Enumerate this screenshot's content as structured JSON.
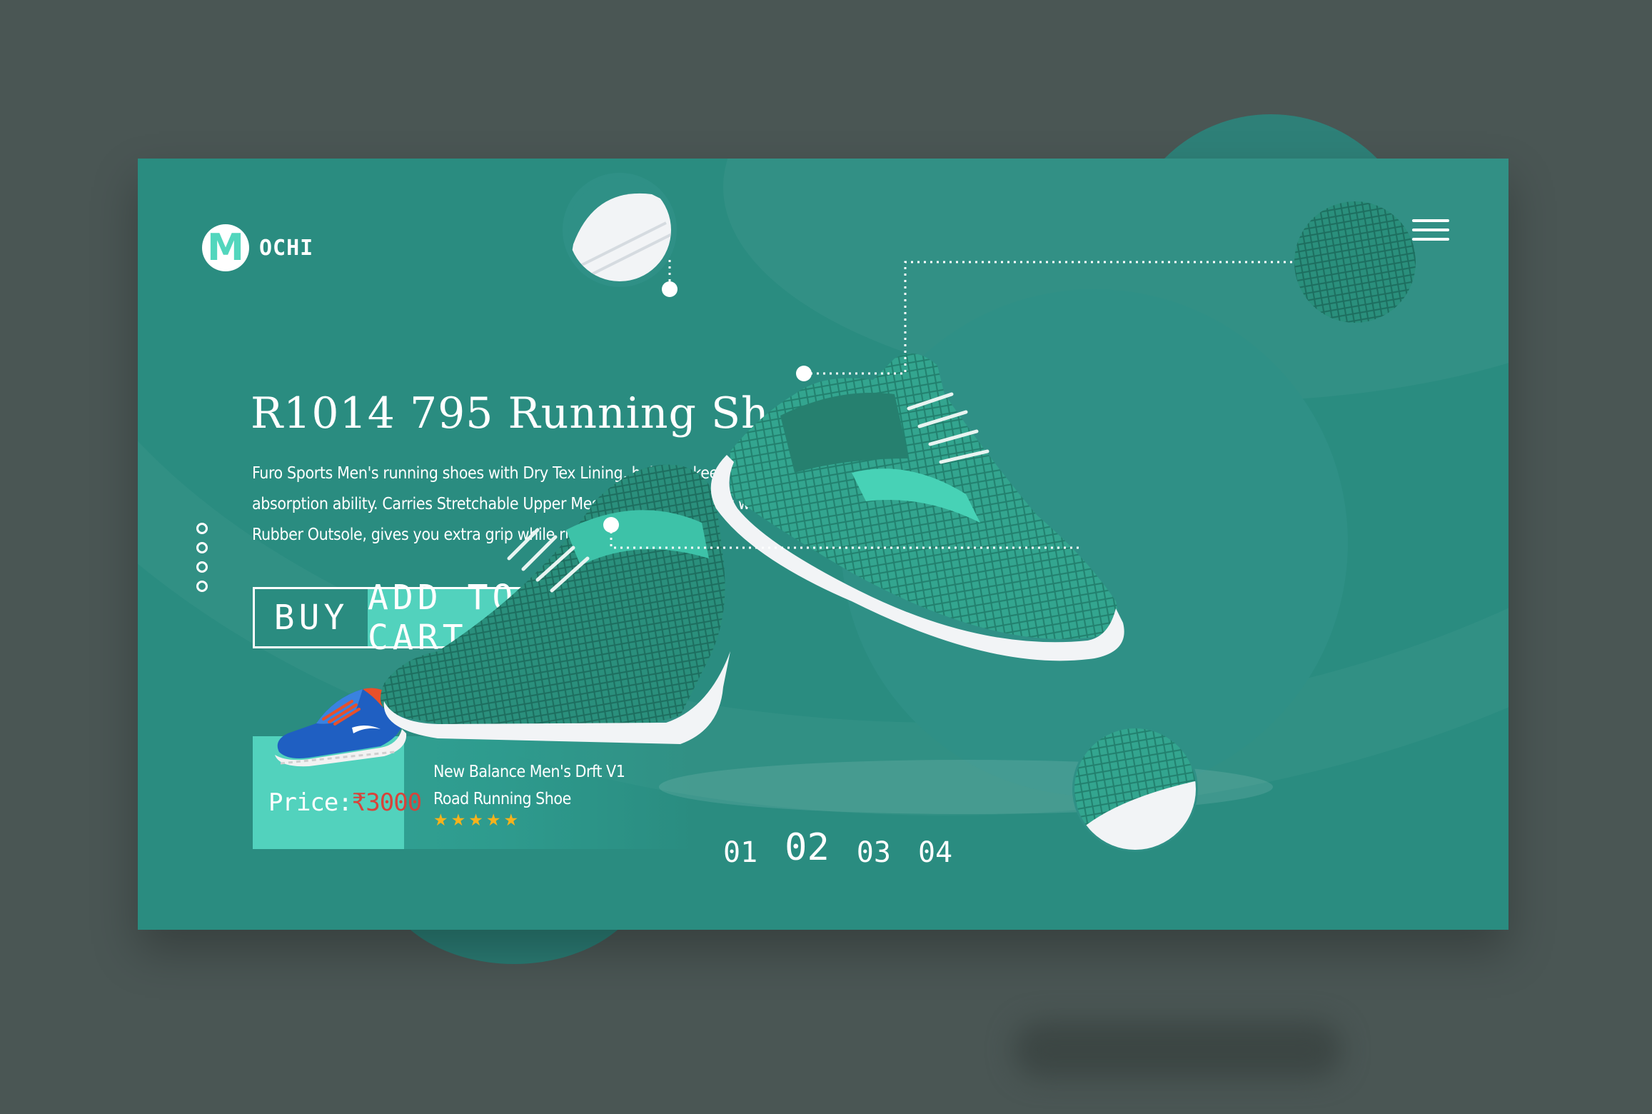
{
  "brand": {
    "mark": "M",
    "name": "OCHI"
  },
  "hero": {
    "title": "R1014 795 Running Shoes",
    "description": "Furo Sports Men's running shoes with Dry Tex Lining, helps to keep your feet dry and also has sweat absorption ability. Carries Stretchable Upper Mesh for extra comfort while on the go & Integrated Rubber Outsole, gives you extra grip while running."
  },
  "actions": {
    "buy_label": "BUY",
    "cart_label": "ADD TO CART"
  },
  "featured_product": {
    "price_label": "Price:",
    "price_value": "₹3000",
    "name_line1": "New Balance Men's Drft V1",
    "name_line2": "Road Running Shoe",
    "rating": 5,
    "stars": "★★★★★"
  },
  "pager": {
    "pages": [
      "01",
      "02",
      "03",
      "04"
    ],
    "active_index": 1
  },
  "slide_dots": {
    "count": 4
  },
  "icons": {
    "menu": "hamburger-menu-icon",
    "rating": "star-icon"
  },
  "colors": {
    "background": "#4a5654",
    "card": "#2a8c80",
    "accent": "#52d2bd",
    "price": "#d8433a",
    "star": "#f7b21c"
  }
}
